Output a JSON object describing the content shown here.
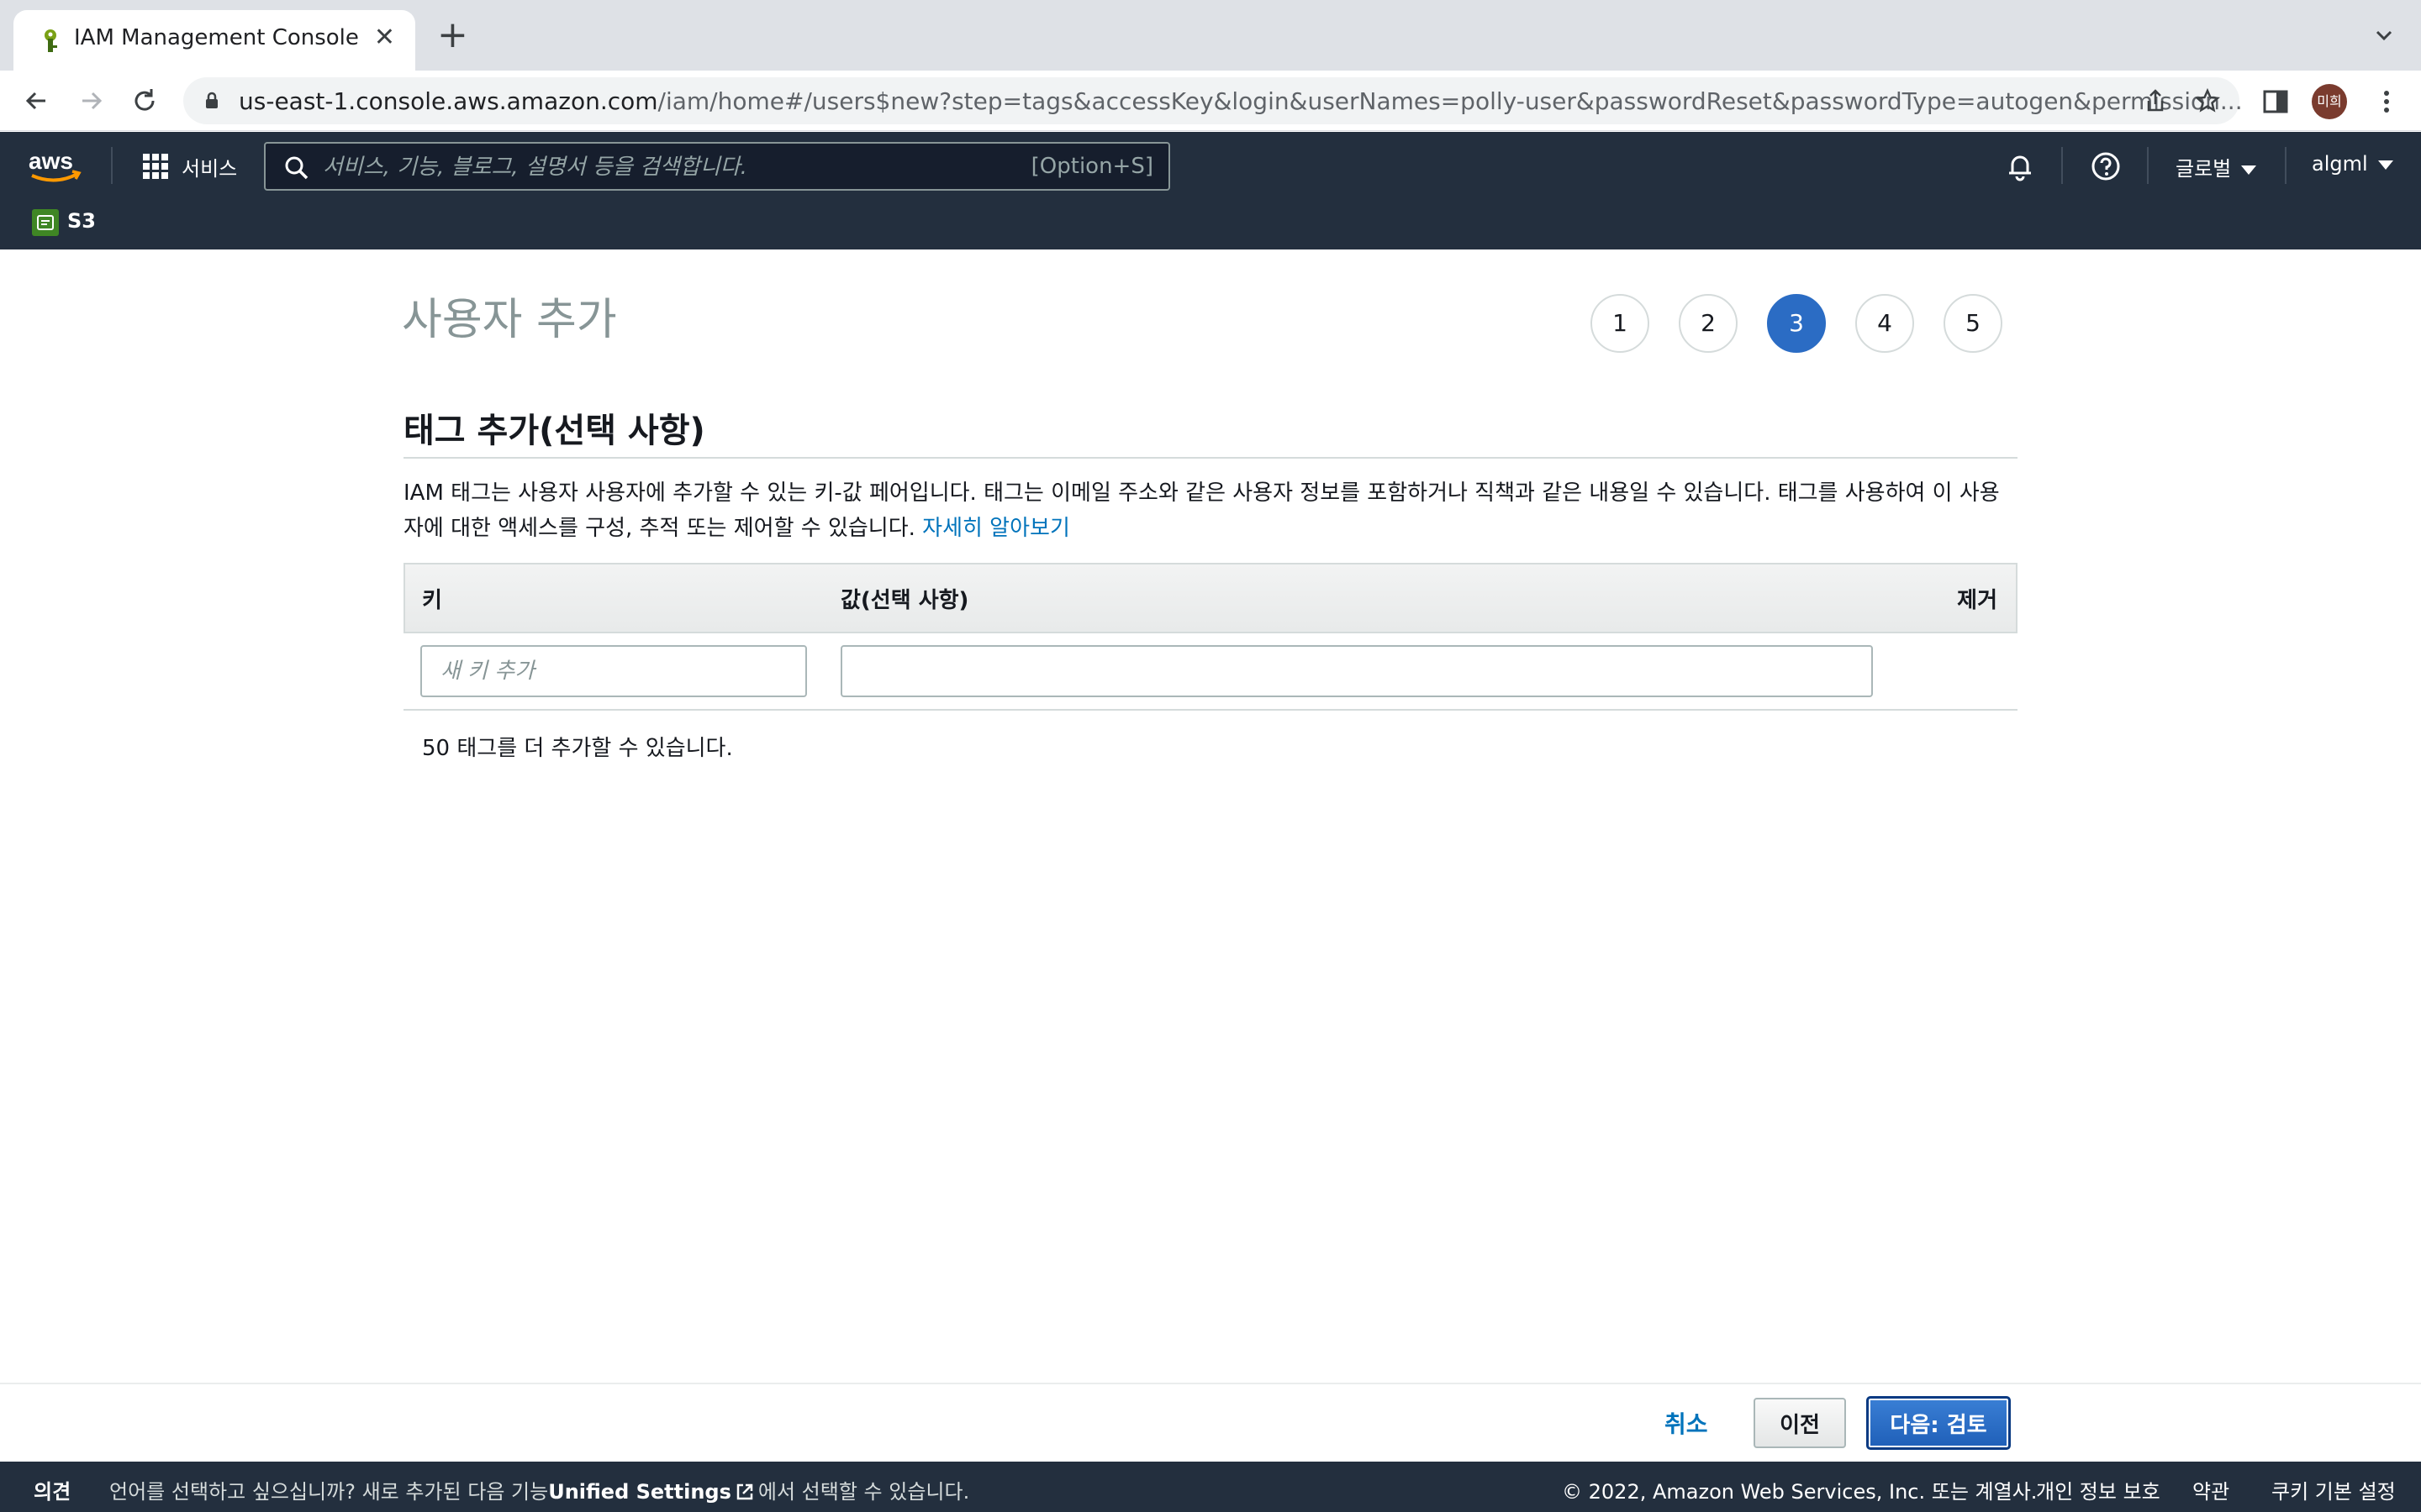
{
  "browser": {
    "tab_title": "IAM Management Console",
    "tab_close": "✕",
    "new_tab": "+",
    "url_host": "us-east-1.console.aws.amazon.com",
    "url_path": "/iam/home#/users$new?step=tags&accessKey&login&userNames=polly-user&passwordReset&passwordType=autogen&permission...",
    "profile_initials": "미희"
  },
  "aws_header": {
    "services_label": "서비스",
    "search_placeholder": "서비스, 기능, 블로그, 설명서 등을 검색합니다.",
    "search_shortcut": "[Option+S]",
    "region_label": "글로벌",
    "account_label": "algml",
    "favorite_s3": "S3"
  },
  "page": {
    "title": "사용자 추가",
    "steps": [
      "1",
      "2",
      "3",
      "4",
      "5"
    ],
    "active_step": "3",
    "section_title": "태그 추가(선택 사항)",
    "description": "IAM 태그는 사용자 사용자에 추가할 수 있는 키-값 페어입니다. 태그는 이메일 주소와 같은 사용자 정보를 포함하거나 직책과 같은 내용일 수 있습니다. 태그를 사용하여 이 사용자에 대한 액세스를 구성, 추적 또는 제어할 수 있습니다.",
    "learn_more": "자세히 알아보기",
    "table": {
      "col_key": "키",
      "col_value": "값(선택 사항)",
      "col_remove": "제거",
      "key_placeholder": "새 키 추가",
      "value_value": ""
    },
    "tags_remaining": "50 태그를 더 추가할 수 있습니다."
  },
  "actions": {
    "cancel": "취소",
    "previous": "이전",
    "next": "다음: 검토"
  },
  "footer": {
    "feedback": "의견",
    "language_prefix": "언어를 선택하고 싶으십니까? 새로 추가된 다음 기능",
    "unified_settings": "Unified Settings",
    "language_suffix": "에서 선택할 수 있습니다.",
    "copyright": "© 2022, Amazon Web Services, Inc. 또는 계열사.",
    "privacy": "개인 정보 보호",
    "terms": "약관",
    "cookie": "쿠키 기본 설정"
  },
  "colors": {
    "aws_nav": "#232f3e",
    "primary": "#2b6cc4",
    "link": "#0073bb"
  }
}
